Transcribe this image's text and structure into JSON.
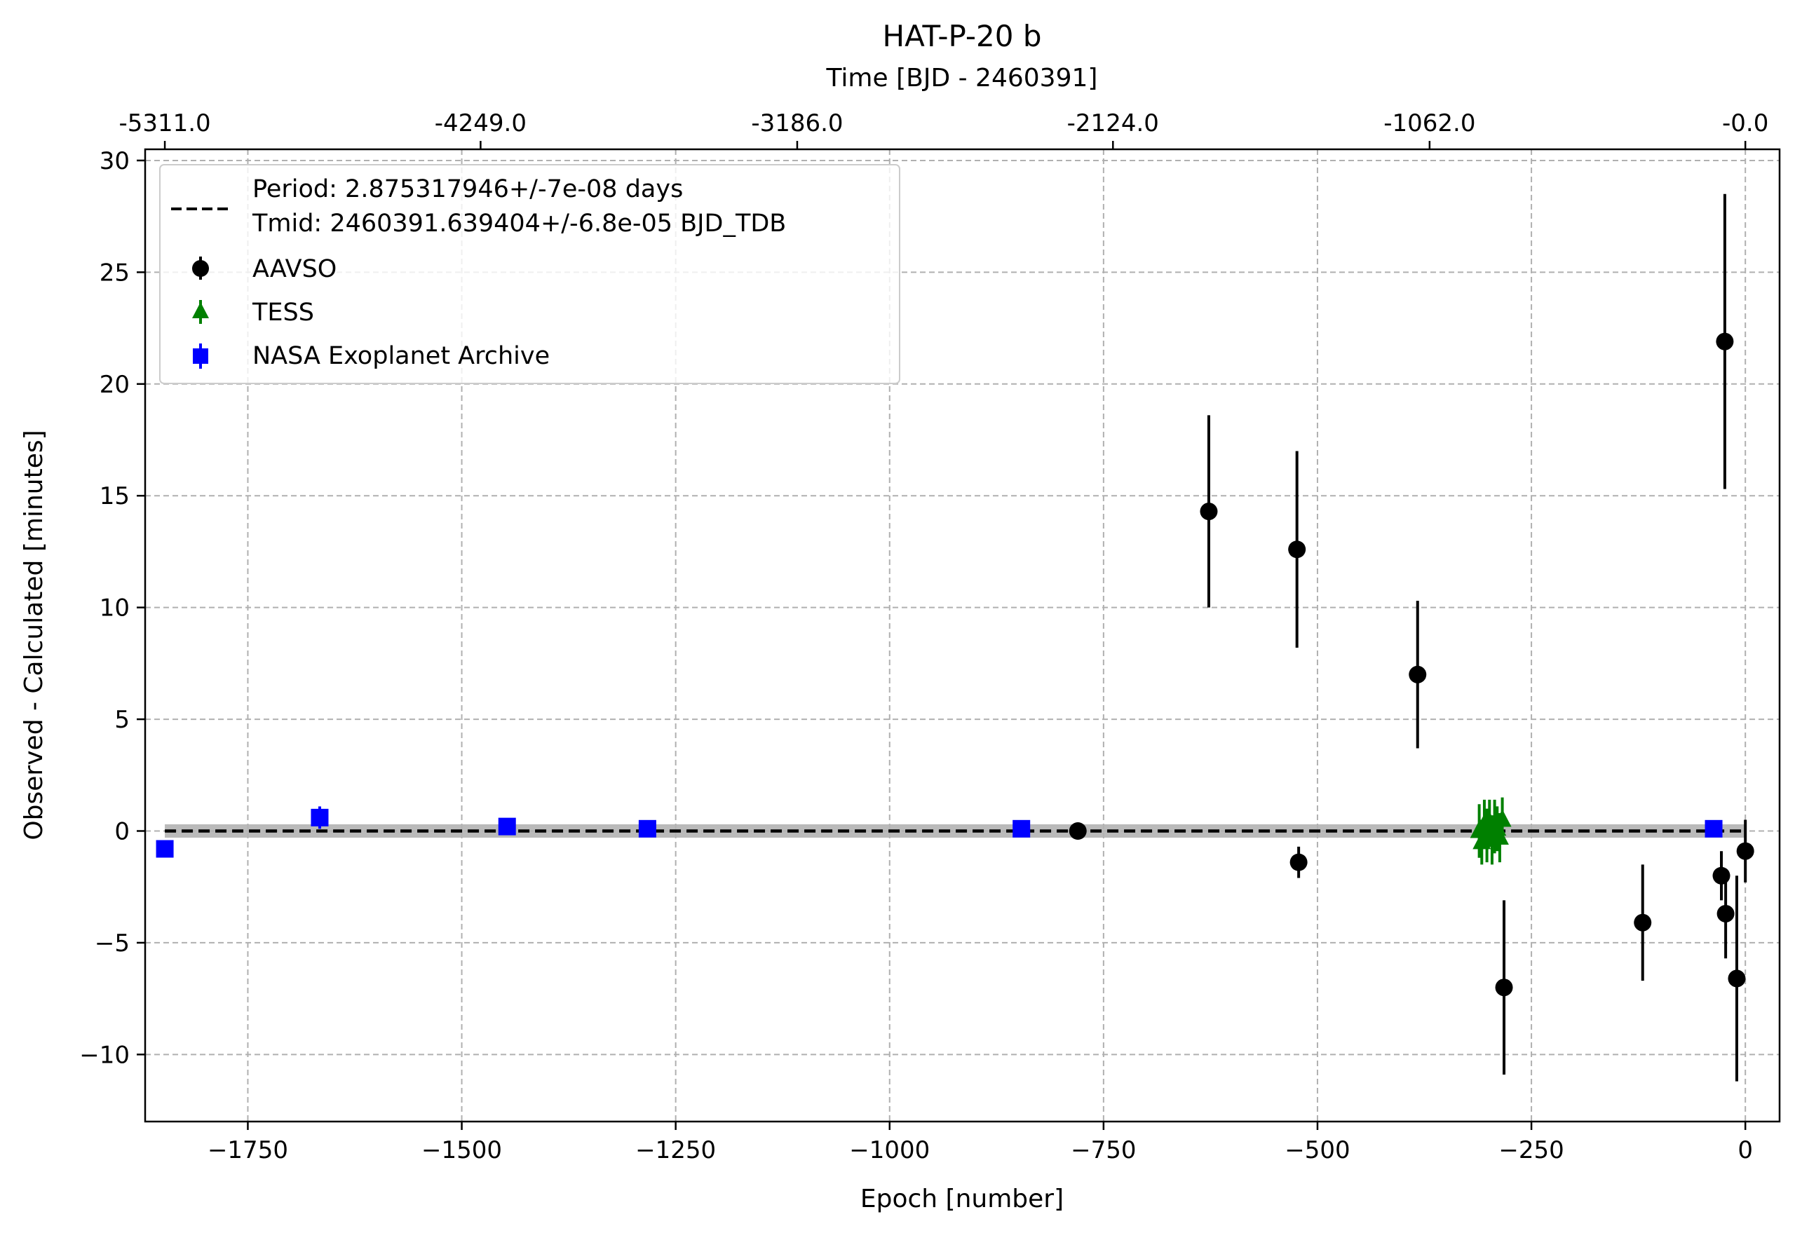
{
  "chart_data": {
    "type": "scatter",
    "title": "HAT-P-20 b",
    "xlabel": "Epoch [number]",
    "ylabel": "Observed - Calculated [minutes]",
    "top_xlabel": "Time [BJD - 2460391]",
    "xlim": [
      -1870,
      40
    ],
    "ylim": [
      -13,
      30.5
    ],
    "grid": true,
    "legend_placement": "upper left",
    "x_ticks": [
      -1750,
      -1500,
      -1250,
      -1000,
      -750,
      -500,
      -250,
      0
    ],
    "x_tick_labels": [
      "−1750",
      "−1500",
      "−1250",
      "−1000",
      "−750",
      "−500",
      "−250",
      "0"
    ],
    "y_ticks": [
      -10,
      -5,
      0,
      5,
      10,
      15,
      20,
      25,
      30
    ],
    "y_tick_labels": [
      "−10",
      "−5",
      "0",
      "5",
      "10",
      "15",
      "20",
      "25",
      "30"
    ],
    "top_ticks_epoch": [
      -1847,
      -1478,
      -1108,
      -739,
      -369,
      0
    ],
    "top_tick_labels": [
      "-5311.0",
      "-4249.0",
      "-3186.0",
      "-2124.0",
      "-1062.0",
      "-0.0"
    ],
    "fit_line": {
      "label_line1": "Period: 2.875317946+/-7e-08 days",
      "label_line2": "Tmid: 2460391.639404+/-6.8e-05 BJD_TDB",
      "x": [
        -1847,
        0
      ],
      "y": [
        0,
        0
      ],
      "band": 0.3,
      "color": "#000000",
      "band_color": "#b3b3b3"
    },
    "series": [
      {
        "name": "AAVSO",
        "color": "#000000",
        "marker": "circle",
        "points": [
          {
            "x": -780,
            "y": 0.0,
            "err": 0.3
          },
          {
            "x": -627,
            "y": 14.3,
            "err": 4.3
          },
          {
            "x": -524,
            "y": 12.6,
            "err": 4.4
          },
          {
            "x": -522,
            "y": -1.4,
            "err": 0.7
          },
          {
            "x": -383,
            "y": 7.0,
            "err": 3.3
          },
          {
            "x": -282,
            "y": -7.0,
            "err": 3.9
          },
          {
            "x": -120,
            "y": -4.1,
            "err": 2.6
          },
          {
            "x": -28,
            "y": -2.0,
            "err": 1.1
          },
          {
            "x": -24,
            "y": 21.9,
            "err": 6.6
          },
          {
            "x": -23,
            "y": -3.7,
            "err": 2.0
          },
          {
            "x": -10,
            "y": -6.6,
            "err": 4.6
          },
          {
            "x": 0,
            "y": -0.9,
            "err": 1.4
          }
        ]
      },
      {
        "name": "TESS",
        "color": "#008000",
        "marker": "triangle",
        "points": [
          {
            "x": -311,
            "y": 0.0,
            "err": 1.2
          },
          {
            "x": -308,
            "y": -0.5,
            "err": 1.0
          },
          {
            "x": -305,
            "y": 0.3,
            "err": 1.1
          },
          {
            "x": -302,
            "y": -0.2,
            "err": 1.2
          },
          {
            "x": -299,
            "y": 0.4,
            "err": 1.0
          },
          {
            "x": -296,
            "y": -0.4,
            "err": 1.1
          },
          {
            "x": -293,
            "y": 0.2,
            "err": 1.2
          },
          {
            "x": -290,
            "y": 0.1,
            "err": 1.0
          },
          {
            "x": -287,
            "y": -0.3,
            "err": 1.1
          },
          {
            "x": -284,
            "y": 0.5,
            "err": 1.0
          }
        ]
      },
      {
        "name": "NASA Exoplanet Archive",
        "color": "#0000ff",
        "marker": "square",
        "points": [
          {
            "x": -1847,
            "y": -0.8,
            "err": 0.2
          },
          {
            "x": -1666,
            "y": 0.6,
            "err": 0.5
          },
          {
            "x": -1447,
            "y": 0.2,
            "err": 0.3
          },
          {
            "x": -1283,
            "y": 0.1,
            "err": 0.2
          },
          {
            "x": -846,
            "y": 0.1,
            "err": 0.2
          },
          {
            "x": -37,
            "y": 0.1,
            "err": 0.2
          }
        ]
      }
    ]
  }
}
